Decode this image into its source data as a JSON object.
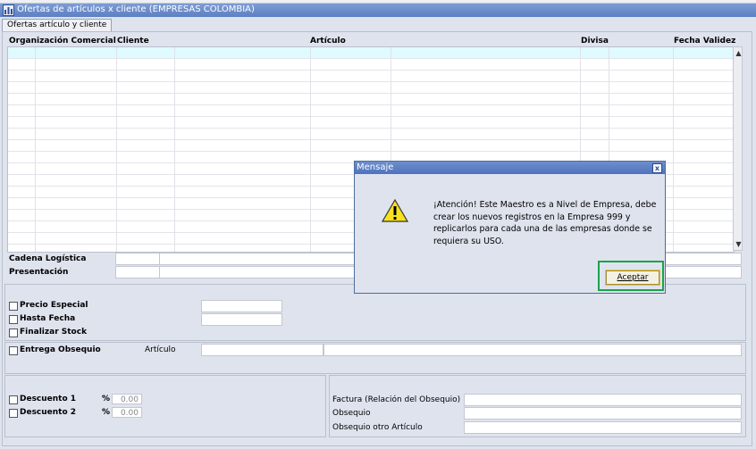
{
  "window": {
    "title": "Ofertas de artículos x cliente (EMPRESAS COLOMBIA)"
  },
  "tab": {
    "label": "Ofertas artículo y cliente"
  },
  "grid": {
    "headers": {
      "org": "Organización Comercial",
      "cliente": "Cliente",
      "articulo": "Artículo",
      "divisa": "Divisa",
      "fecha": "Fecha Validez"
    }
  },
  "form": {
    "cadena_label": "Cadena Logística",
    "presentacion_label": "Presentación",
    "precio_especial": "Precio Especial",
    "hasta_fecha": "Hasta Fecha",
    "finalizar_stock": "Finalizar Stock",
    "entrega_obsequio": "Entrega Obsequio",
    "articulo_label": "Artículo",
    "descuento1": "Descuento 1",
    "descuento2": "Descuento 2",
    "pct": "%",
    "desc1_value": "0.00",
    "desc2_value": "0.00",
    "factura_label": "Factura (Relación del Obsequio)",
    "obsequio_label": "Obsequio",
    "obsequio_otro_label": "Obsequio otro Artículo"
  },
  "dialog": {
    "title": "Mensaje",
    "close_glyph": "x",
    "message": "¡Atención! Este Maestro es a Nivel de Empresa, debe crear los nuevos registros en la Empresa 999 y replicarlos para cada una de las empresas donde se requiera su USO.",
    "ok_label": "Aceptar",
    "icon": "warning-icon"
  },
  "colors": {
    "titlebar": "#5d80c4",
    "selected_row": "#e0fbff",
    "focus_frame": "#1aa34a"
  }
}
